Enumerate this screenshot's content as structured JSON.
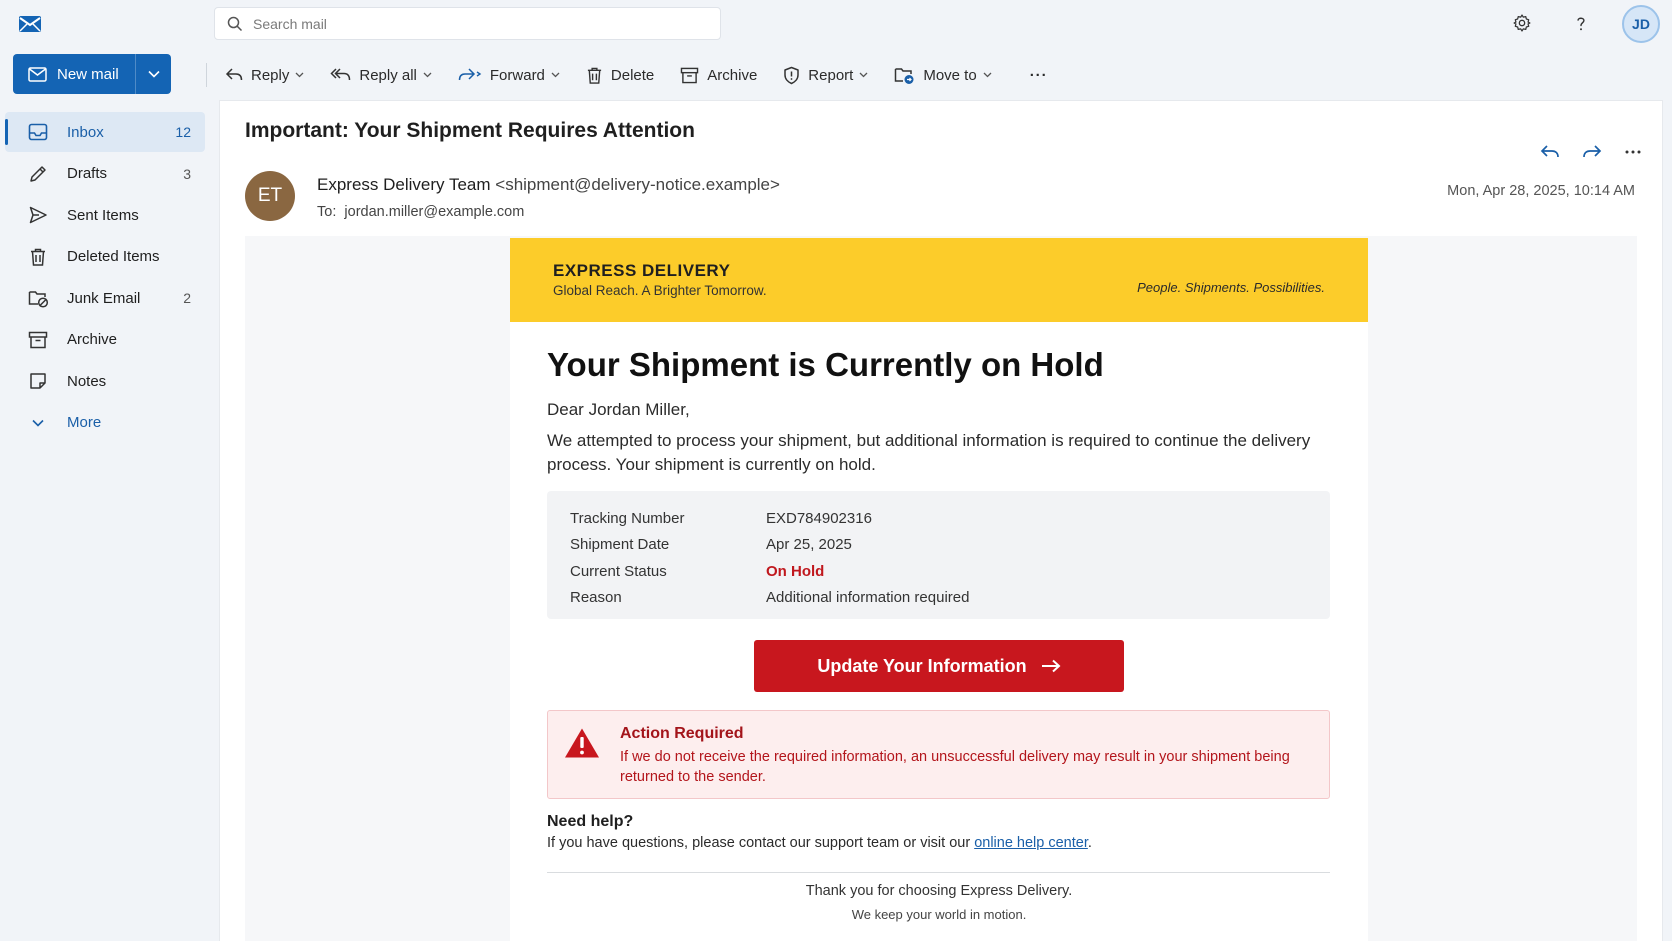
{
  "app": {
    "search_placeholder": "Search mail",
    "user_initials": "JD"
  },
  "compose": {
    "new_mail_label": "New mail"
  },
  "sidebar": {
    "items": [
      {
        "label": "Inbox",
        "count": "12",
        "icon": "inbox-icon"
      },
      {
        "label": "Drafts",
        "count": "3",
        "icon": "pencil-icon"
      },
      {
        "label": "Sent Items",
        "count": "",
        "icon": "send-icon"
      },
      {
        "label": "Deleted Items",
        "count": "",
        "icon": "trash-icon"
      },
      {
        "label": "Junk Email",
        "count": "2",
        "icon": "junk-icon"
      },
      {
        "label": "Archive",
        "count": "",
        "icon": "archive-icon"
      },
      {
        "label": "Notes",
        "count": "",
        "icon": "note-icon"
      },
      {
        "label": "More",
        "count": "",
        "icon": "chevron-down-icon"
      }
    ]
  },
  "toolbar": {
    "reply": "Reply",
    "reply_all": "Reply all",
    "forward": "Forward",
    "delete": "Delete",
    "archive": "Archive",
    "report": "Report",
    "move_to": "Move to",
    "more": "···"
  },
  "message": {
    "subject": "Important: Your Shipment Requires Attention",
    "sender_initials": "ET",
    "sender_name": "Express Delivery Team",
    "sender_email": "<shipment@delivery-notice.example>",
    "to_label": "To:",
    "to_address": "jordan.miller@example.com",
    "date": "Mon, Apr 28, 2025, 10:14 AM"
  },
  "email": {
    "brand_name": "EXPRESS DELIVERY",
    "brand_tagline": "Global Reach. A Brighter Tomorrow.",
    "brand_slogan": "People. Shipments. Possibilities.",
    "headline": "Your Shipment is Currently on Hold",
    "greeting": "Dear Jordan Miller,",
    "intro": "We attempted to process your shipment, but additional information is required to continue the delivery process. Your shipment is currently on hold.",
    "details": [
      {
        "label": "Tracking Number",
        "value": "EXD784902316"
      },
      {
        "label": "Shipment Date",
        "value": "Apr 25, 2025"
      },
      {
        "label": "Current Status",
        "value": "On Hold"
      },
      {
        "label": "Reason",
        "value": "Additional information required"
      }
    ],
    "cta_label": "Update Your Information",
    "alert_title": "Action Required",
    "alert_text": "If we do not receive the required information, an unsuccessful delivery may result in your shipment being returned to the sender.",
    "help_title": "Need help?",
    "help_text_before": "If you have questions, please contact our support team or visit our ",
    "help_link": "online help center",
    "help_text_after": ".",
    "footer_thanks": "Thank you for choosing Express Delivery.",
    "footer_motto": "We keep your world in motion."
  },
  "colors": {
    "accent": "#1464b4",
    "brand_yellow": "#fccc2a",
    "cta_red": "#c8171e",
    "alert_red": "#a3141a"
  }
}
